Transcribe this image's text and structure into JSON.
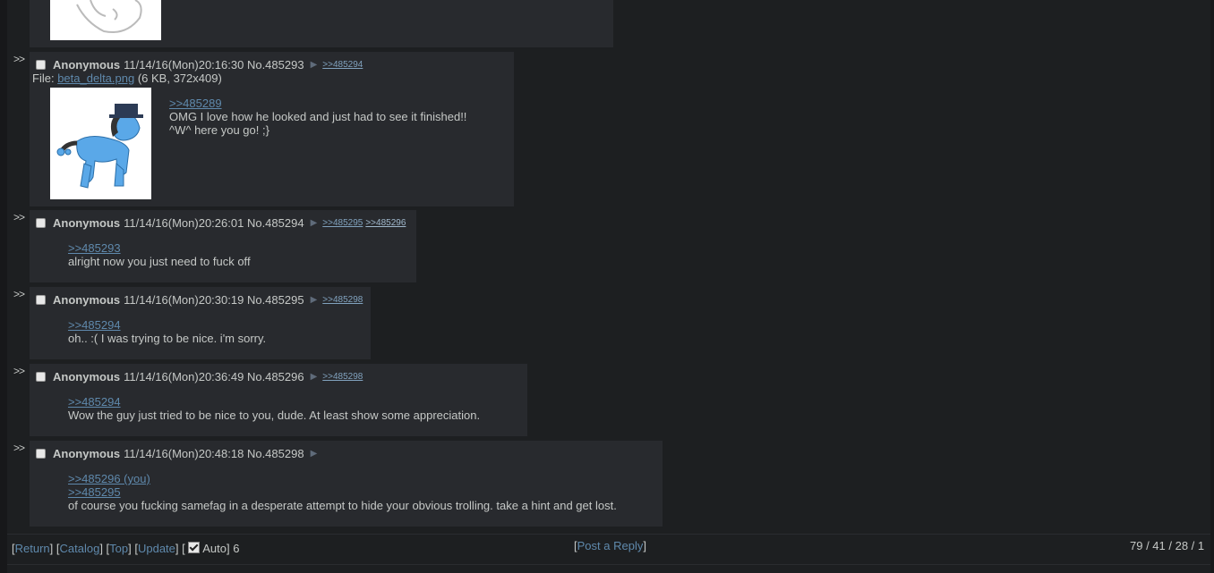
{
  "posts": [
    {
      "name": "Anonymous",
      "date": "11/14/16(Mon)20:16:30",
      "num": "No.485293",
      "backlinks": [
        ">>485294"
      ],
      "file_label": "File:",
      "file_name": "beta_delta.png",
      "file_meta": "(6 KB, 372x409)",
      "quote": ">>485289",
      "lines": [
        "OMG I love how he looked and just had to see it finished!!",
        "^W^ here you go! ;}"
      ]
    },
    {
      "name": "Anonymous",
      "date": "11/14/16(Mon)20:26:01",
      "num": "No.485294",
      "backlinks": [
        ">>485295",
        ">>485296"
      ],
      "quote": ">>485293",
      "lines": [
        "alright now you just need to fuck off"
      ]
    },
    {
      "name": "Anonymous",
      "date": "11/14/16(Mon)20:30:19",
      "num": "No.485295",
      "backlinks": [
        ">>485298"
      ],
      "quote": ">>485294",
      "lines": [
        "oh.. :( I was trying to be nice. i'm sorry."
      ]
    },
    {
      "name": "Anonymous",
      "date": "11/14/16(Mon)20:36:49",
      "num": "No.485296",
      "backlinks": [
        ">>485298"
      ],
      "quote": ">>485294",
      "lines": [
        "Wow the guy just tried to be nice to you, dude. At least show some appreciation."
      ]
    },
    {
      "name": "Anonymous",
      "date": "11/14/16(Mon)20:48:18",
      "num": "No.485298",
      "backlinks": [],
      "quote": ">>485296 (you)",
      "quote2": ">>485295",
      "lines": [
        "of course you fucking samefag in a desperate attempt to hide your obvious trolling. take a hint and get lost."
      ]
    }
  ],
  "arrows": ">>",
  "footer": {
    "return": "Return",
    "catalog": "Catalog",
    "top": "Top",
    "update": "Update",
    "auto": "Auto",
    "count": "6",
    "post_reply": "Post a Reply",
    "stats": "79 / 41 / 28 / 1"
  },
  "colors": {
    "background": "#1d1f21",
    "post_bg": "#282a2e",
    "link": "#5f89ac",
    "text": "#c5c8c6"
  }
}
